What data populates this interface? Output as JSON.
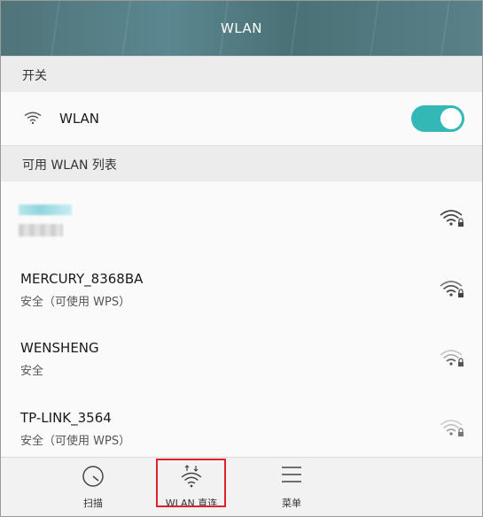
{
  "titlebar": {
    "title": "WLAN"
  },
  "switch_section": {
    "header": "开关"
  },
  "wlan_toggle": {
    "label": "WLAN",
    "on": true,
    "accent": "#33b7b7"
  },
  "networks_section": {
    "header": "可用 WLAN 列表"
  },
  "networks": [
    {
      "ssid": "",
      "security": "",
      "signal": "wifi-locked-icon",
      "blurred": true
    },
    {
      "ssid": "MERCURY_8368BA",
      "security": "安全（可使用 WPS）",
      "signal": "wifi-locked-icon"
    },
    {
      "ssid": "WENSHENG",
      "security": "安全",
      "signal": "wifi-locked-icon"
    },
    {
      "ssid": "TP-LINK_3564",
      "security": "安全（可使用 WPS）",
      "signal": "wifi-locked-icon"
    }
  ],
  "bottom_nav": {
    "scan": {
      "label": "扫描",
      "icon": "scan-icon"
    },
    "direct": {
      "label": "WLAN 直连",
      "icon": "wifi-direct-icon",
      "highlight_color": "#e0212b"
    },
    "menu": {
      "label": "菜单",
      "icon": "menu-icon"
    }
  }
}
